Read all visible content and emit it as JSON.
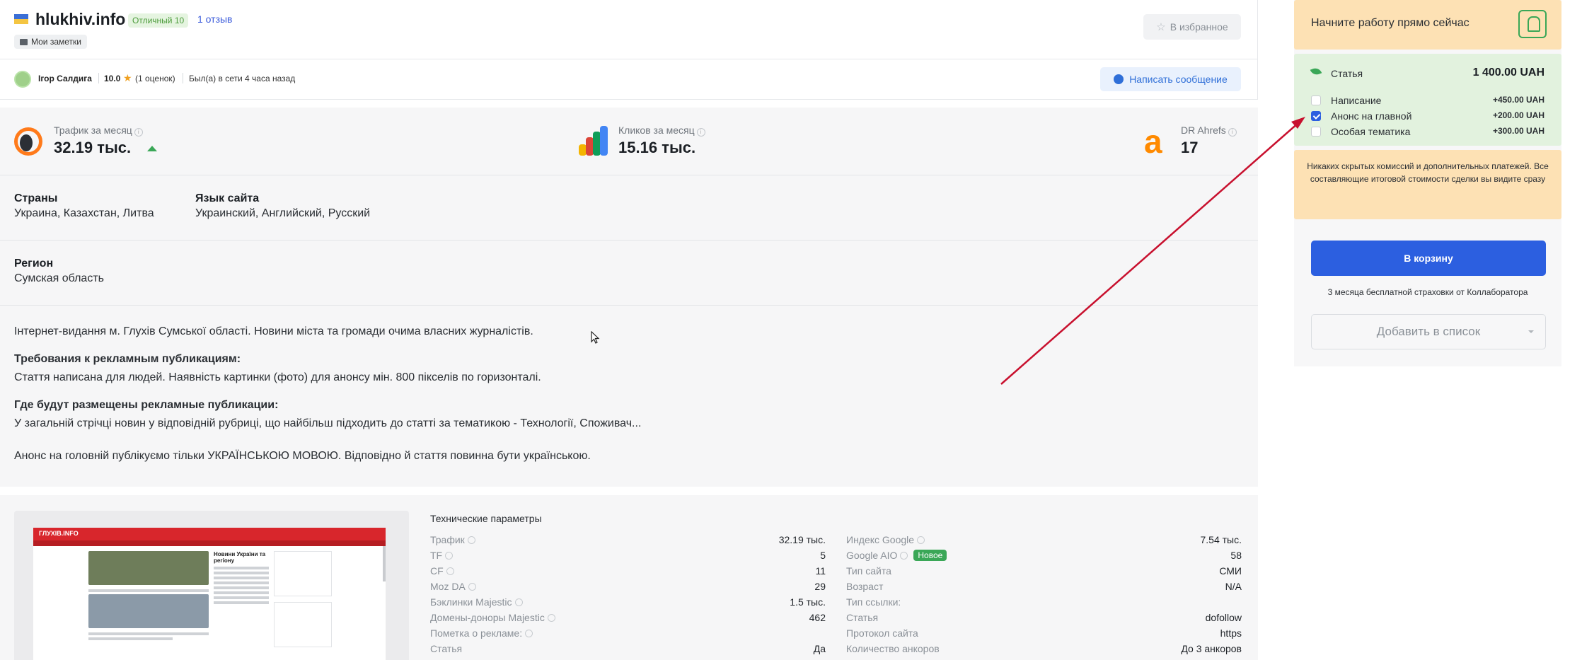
{
  "header": {
    "site_title": "hlukhiv.info",
    "rating_badge": "Отличный 10",
    "reviews_link": "1 отзыв",
    "notes_label": "Мои заметки",
    "favorites_label": "В избранное"
  },
  "user": {
    "name": "Ігор Салдига",
    "score": "10.0",
    "ratings_count": "(1 оценок)",
    "online_status": "Был(а) в сети 4 часа назад",
    "message_button": "Написать сообщение"
  },
  "metrics": {
    "traffic_label": "Трафик за месяц",
    "traffic_value": "32.19 тыс.",
    "clicks_label": "Кликов за месяц",
    "clicks_value": "15.16 тыс.",
    "dr_label": "DR Ahrefs",
    "dr_value": "17"
  },
  "facts": {
    "countries_title": "Страны",
    "countries_value": "Украина, Казахстан, Литва",
    "language_title": "Язык сайта",
    "language_value": "Украинский, Английский, Русский",
    "region_title": "Регион",
    "region_value": "Сумская область"
  },
  "description": {
    "intro": "Інтернет-видання м. Глухів Сумської області. Новини міста та громади очима власних журналістів.",
    "req_title": "Требования к рекламным публикациям:",
    "req_text": "Стаття написана для людей. Наявність картинки (фото) для анонсу мін. 800 пікселів по горизонталі.",
    "where_title": "Где будут размещены рекламные публикации:",
    "where_text": "У загальній стрічці новин у відповідній рубриці, що найбільш підходить до статті за тематикою - Технології, Споживач...",
    "announce_text": "Анонс на головній публікуємо тільки УКРАЇНСЬКОЮ МОВОЮ. Відповідно й стаття повинна бути українською."
  },
  "preview": {
    "site_header": "ГЛУХІВ.INFO",
    "news_title": "Новини України та регіону"
  },
  "tech": {
    "title": "Технические параметры",
    "left": [
      {
        "key": "Трафик",
        "value": "32.19 тыс."
      },
      {
        "key": "TF",
        "value": "5"
      },
      {
        "key": "CF",
        "value": "11"
      },
      {
        "key": "Moz DA",
        "value": "29"
      },
      {
        "key": "Бэклинки Majestic",
        "value": "1.5 тыс."
      },
      {
        "key": "Домены-доноры Majestic",
        "value": "462"
      },
      {
        "key": "Пометка о рекламе:",
        "value": ""
      },
      {
        "key": "Статья",
        "value": "Да"
      }
    ],
    "right": [
      {
        "key": "Индекс Google",
        "value": "7.54 тыс."
      },
      {
        "key": "Google AIO",
        "value": "58",
        "badge": "Новое"
      },
      {
        "key": "Тип сайта",
        "value": "СМИ"
      },
      {
        "key": "Возраст",
        "value": "N/A"
      },
      {
        "key": "Тип ссылки:",
        "value": ""
      },
      {
        "key": "Статья",
        "value": "dofollow"
      },
      {
        "key": "Протокол сайта",
        "value": "https"
      },
      {
        "key": "Количество анкоров",
        "value": "До 3 анкоров"
      }
    ]
  },
  "sidebar": {
    "start_text": "Начните работу прямо сейчас",
    "article_label": "Статья",
    "article_price": "1 400.00 UAH",
    "options": [
      {
        "label": "Написание",
        "price": "+450.00 UAH",
        "checked": false
      },
      {
        "label": "Анонс на главной",
        "price": "+200.00 UAH",
        "checked": true
      },
      {
        "label": "Особая тематика",
        "price": "+300.00 UAH",
        "checked": false
      }
    ],
    "notice": "Никаких скрытых комиссий и дополнительных платежей. Все составляющие итоговой стоимости сделки вы видите сразу",
    "cart_button": "В корзину",
    "insurance": "3 месяца бесплатной страховки от Коллаборатора",
    "list_button": "Добавить в список"
  },
  "colors": {
    "accent_blue": "#2c5fe0",
    "success_green": "#3aa757",
    "warning_bg": "#fde1b4",
    "arrow_red": "#c8102e"
  }
}
